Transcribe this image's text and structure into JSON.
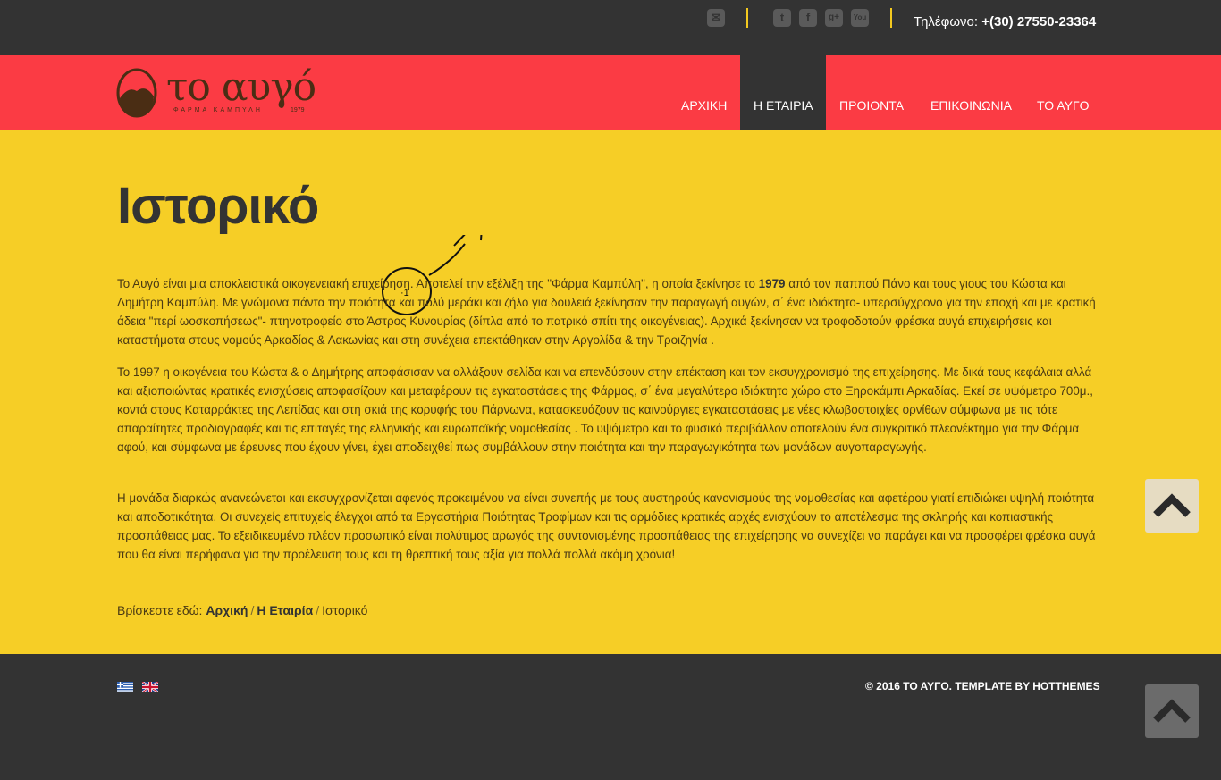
{
  "topbar": {
    "phone_label": "Τηλέφωνο:",
    "phone_number": "+(30) 27550-23364",
    "accent_color": "#f4c91f"
  },
  "header": {
    "logo_name": "το αυγό",
    "logo_sub": "ΦΑΡΜΑ ΚΑΜΠΥΛΗ",
    "logo_year": "1979",
    "nav": [
      {
        "label": "ΑΡΧΙΚΗ"
      },
      {
        "label": "Η ΕΤΑΙΡΙΑ"
      },
      {
        "label": "ΠΡΟΙΟΝΤΑ"
      },
      {
        "label": "ΕΠΙΚΟΙΝΩΝΙΑ"
      },
      {
        "label": "ΤΟ ΑΥΓΟ"
      }
    ],
    "color": "#fb3b44"
  },
  "main": {
    "title": "Ιστορικό",
    "p1_a": "Το Αυγό είναι μια αποκλειστικά οικογενειακή επιχείρηση. Αποτελεί την εξέλιξη της \"Φάρμα Καμπύλη\", η οποία ξεκίνησε το ",
    "p1_year": "1979",
    "p1_b": " από τον παππού Πάνο και τους γιους του Κώστα και Δημήτρη Καμπύλη. Με γνώμονα πάντα την ποιότητα και πολύ μεράκι και ζήλο για δουλειά ξεκίνησαν την παραγωγή αυγών, σ΄ ένα ιδιόκτητο- υπερσύγχρονο για την εποχή και με κρατική άδεια \"περί ωοσκοπήσεως\"- πτηνοτροφείο στο Άστρος Κυνουρίας (δίπλα από το πατρικό σπίτι της οικογένειας). Αρχικά ξεκίνησαν να τροφοδοτούν φρέσκα αυγά επιχειρήσεις και καταστήματα στους νομούς Αρκαδίας & Λακωνίας και στη συνέχεια επεκτάθηκαν στην Αργολίδα & την Τροιζηνία .",
    "p2": "Το 1997 η οικογένεια του Κώστα & ο Δημήτρης αποφάσισαν να αλλάξουν σελίδα και να επενδύσουν στην επέκταση και τον εκσυγχρονισμό της επιχείρησης. Με δικά τους κεφάλαια αλλά και αξιοποιώντας κρατικές ενισχύσεις αποφασίζουν και μεταφέρουν τις εγκαταστάσεις της Φάρμας, σ΄ ένα μεγαλύτερο ιδιόκτητο χώρο στο Ξηροκάμπι Αρκαδίας. Εκεί σε υψόμετρο 700μ., κοντά στους Καταρράκτες της Λεπίδας και στη σκιά της κορυφής του Πάρνωνα, κατασκευάζουν τις καινούργιες εγκαταστάσεις με νέες κλωβοστοιχίες ορνίθων σύμφωνα με τις τότε απαραίτητες προδιαγραφές και τις επιταγές της ελληνικής και ευρωπαϊκής νομοθεσίας . Το υψόμετρο και το φυσικό περιβάλλον αποτελούν ένα συγκριτικό πλεονέκτημα για την Φάρμα αφού, και σύμφωνα με έρευνες που έχουν γίνει, έχει αποδειχθεί πως συμβάλλουν στην ποιότητα και την παραγωγικότητα των μονάδων αυγοπαραγωγής.",
    "p3": "Η μονάδα διαρκώς ανανεώνεται και εκσυγχρονίζεται αφενός προκειμένου να είναι συνεπής με τους αυστηρούς κανονισμούς της νομοθεσίας και αφετέρου γιατί επιδιώκει υψηλή ποιότητα και αποδοτικότητα. Οι συνεχείς επιτυχείς έλεγχοι από τα Εργαστήρια Ποιότητας Τροφίμων και τις αρμόδιες κρατικές αρχές ενισχύουν το αποτέλεσμα της σκληρής και κοπιαστικής προσπάθειας μας. Το εξειδικευμένο πλέον προσωπικό είναι πολύτιμος αρωγός της συντονισμένης προσπάθειας της επιχείρησης να συνεχίζει να παράγει και να προσφέρει φρέσκα αυγά που θα είναι περήφανα για την προέλευση τους και τη θρεπτική τους αξία για πολλά πολλά ακόμη χρόνια!",
    "annotation": "·1",
    "color": "#f6ce26"
  },
  "breadcrumb": {
    "prefix": "Βρίσκεστε εδώ:",
    "home": "Αρχική",
    "company": "Η Εταιρία",
    "current": "Ιστορικό"
  },
  "footer": {
    "copy_a": "© 2016 ΤΟ ΑΥΓΟ. TEMPLATE BY ",
    "copy_b": "HOTTHEMES"
  }
}
